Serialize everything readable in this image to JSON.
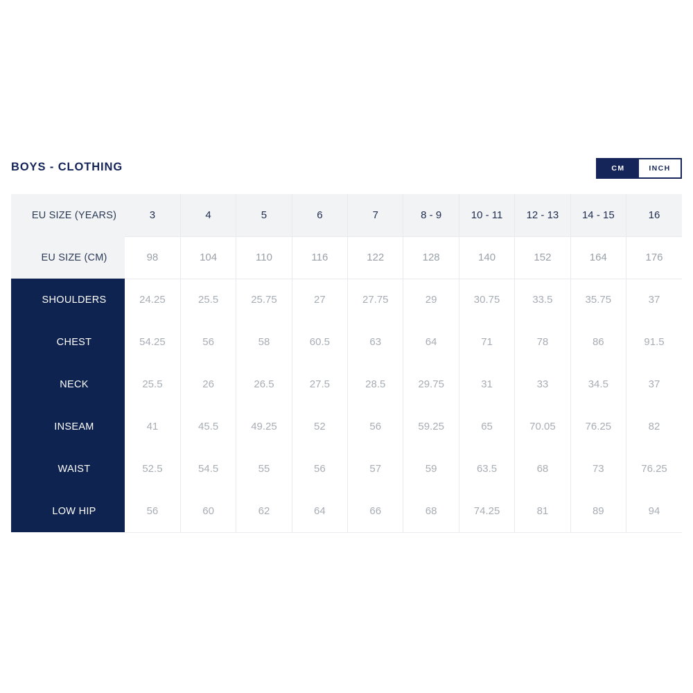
{
  "chart": {
    "title": "BOYS - CLOTHING",
    "units": {
      "options": [
        {
          "label": "CM",
          "active": true
        },
        {
          "label": "INCH",
          "active": false
        }
      ]
    },
    "colors": {
      "navy": "#15255a",
      "label_navy": "#0f2350",
      "header_gray": "#f2f3f5",
      "value_gray": "#a7adb4",
      "border": "#e8eaed"
    }
  },
  "chart_data": {
    "type": "table",
    "title": "BOYS - CLOTHING",
    "unit": "CM",
    "row_label_header": "",
    "header_rows": [
      {
        "label": "EU SIZE (YEARS)",
        "values": [
          "3",
          "4",
          "5",
          "6",
          "7",
          "8 - 9",
          "10 - 11",
          "12 - 13",
          "14 - 15",
          "16"
        ]
      },
      {
        "label": "EU SIZE (CM)",
        "values": [
          "98",
          "104",
          "110",
          "116",
          "122",
          "128",
          "140",
          "152",
          "164",
          "176"
        ]
      }
    ],
    "categories": [
      "3",
      "4",
      "5",
      "6",
      "7",
      "8 - 9",
      "10 - 11",
      "12 - 13",
      "14 - 15",
      "16"
    ],
    "measurement_rows": [
      {
        "label": "SHOULDERS",
        "values": [
          "24.25",
          "25.5",
          "25.75",
          "27",
          "27.75",
          "29",
          "30.75",
          "33.5",
          "35.75",
          "37"
        ]
      },
      {
        "label": "CHEST",
        "values": [
          "54.25",
          "56",
          "58",
          "60.5",
          "63",
          "64",
          "71",
          "78",
          "86",
          "91.5"
        ]
      },
      {
        "label": "NECK",
        "values": [
          "25.5",
          "26",
          "26.5",
          "27.5",
          "28.5",
          "29.75",
          "31",
          "33",
          "34.5",
          "37"
        ]
      },
      {
        "label": "INSEAM",
        "values": [
          "41",
          "45.5",
          "49.25",
          "52",
          "56",
          "59.25",
          "65",
          "70.05",
          "76.25",
          "82"
        ]
      },
      {
        "label": "WAIST",
        "values": [
          "52.5",
          "54.5",
          "55",
          "56",
          "57",
          "59",
          "63.5",
          "68",
          "73",
          "76.25"
        ]
      },
      {
        "label": "LOW HIP",
        "values": [
          "56",
          "60",
          "62",
          "64",
          "66",
          "68",
          "74.25",
          "81",
          "89",
          "94"
        ]
      }
    ]
  }
}
